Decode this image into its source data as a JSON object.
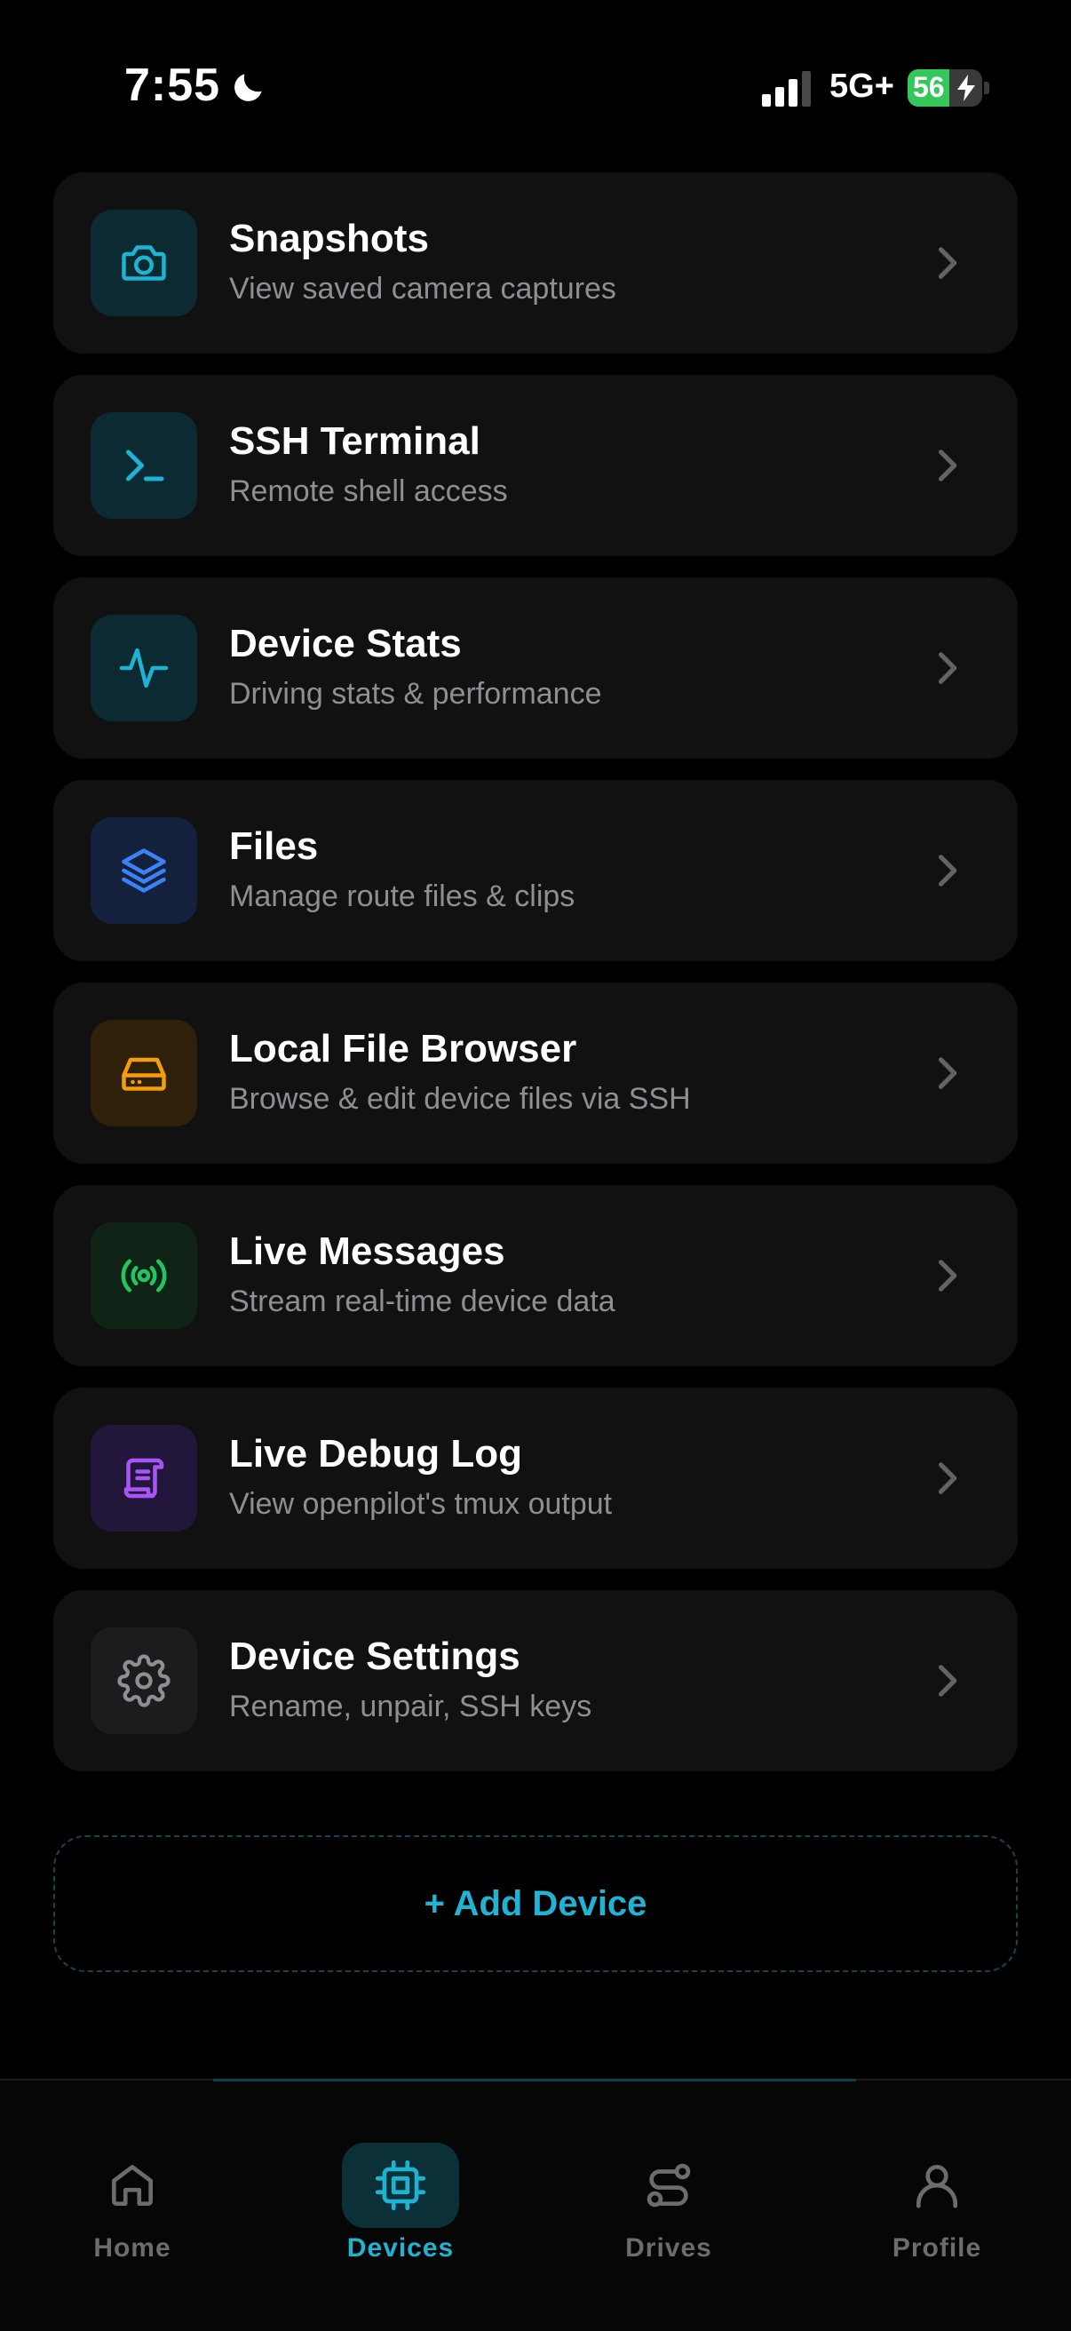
{
  "status_bar": {
    "time": "7:55",
    "network": "5G+",
    "battery_percent": "56",
    "battery_level": 0.56,
    "icons": [
      "moon-icon",
      "cellular-signal-icon",
      "battery-icon",
      "charging-bolt-icon"
    ]
  },
  "menu": {
    "items": [
      {
        "title": "Snapshots",
        "subtitle": "View saved camera captures",
        "icon": "camera-icon",
        "accent": "#1fb3d3",
        "icon_bg": "#0b2a31"
      },
      {
        "title": "SSH Terminal",
        "subtitle": "Remote shell access",
        "icon": "terminal-icon",
        "accent": "#1fb3d3",
        "icon_bg": "#0b2a31"
      },
      {
        "title": "Device Stats",
        "subtitle": "Driving stats & performance",
        "icon": "activity-pulse-icon",
        "accent": "#1fb3d3",
        "icon_bg": "#0b2a31"
      },
      {
        "title": "Files",
        "subtitle": "Manage route files & clips",
        "icon": "layers-icon",
        "accent": "#3b82f6",
        "icon_bg": "#14213d"
      },
      {
        "title": "Local File Browser",
        "subtitle": "Browse & edit device files via SSH",
        "icon": "hard-drive-icon",
        "accent": "#f59e0b",
        "icon_bg": "#2e2009"
      },
      {
        "title": "Live Messages",
        "subtitle": "Stream real-time device data",
        "icon": "radio-broadcast-icon",
        "accent": "#22c55e",
        "icon_bg": "#0f2417"
      },
      {
        "title": "Live Debug Log",
        "subtitle": "View openpilot's tmux output",
        "icon": "scroll-icon",
        "accent": "#a855f7",
        "icon_bg": "#22173a"
      },
      {
        "title": "Device Settings",
        "subtitle": "Rename, unpair, SSH keys",
        "icon": "gear-icon",
        "accent": "#8e8e93",
        "icon_bg": "#1c1c1e"
      }
    ]
  },
  "add_device": {
    "label": "+ Add Device",
    "accent": "#20b4d4"
  },
  "bottom_nav": {
    "items": [
      {
        "label": "Home",
        "icon": "home-icon",
        "active": false
      },
      {
        "label": "Devices",
        "icon": "chip-icon",
        "active": true
      },
      {
        "label": "Drives",
        "icon": "route-icon",
        "active": false
      },
      {
        "label": "Profile",
        "icon": "user-icon",
        "active": false
      }
    ]
  }
}
